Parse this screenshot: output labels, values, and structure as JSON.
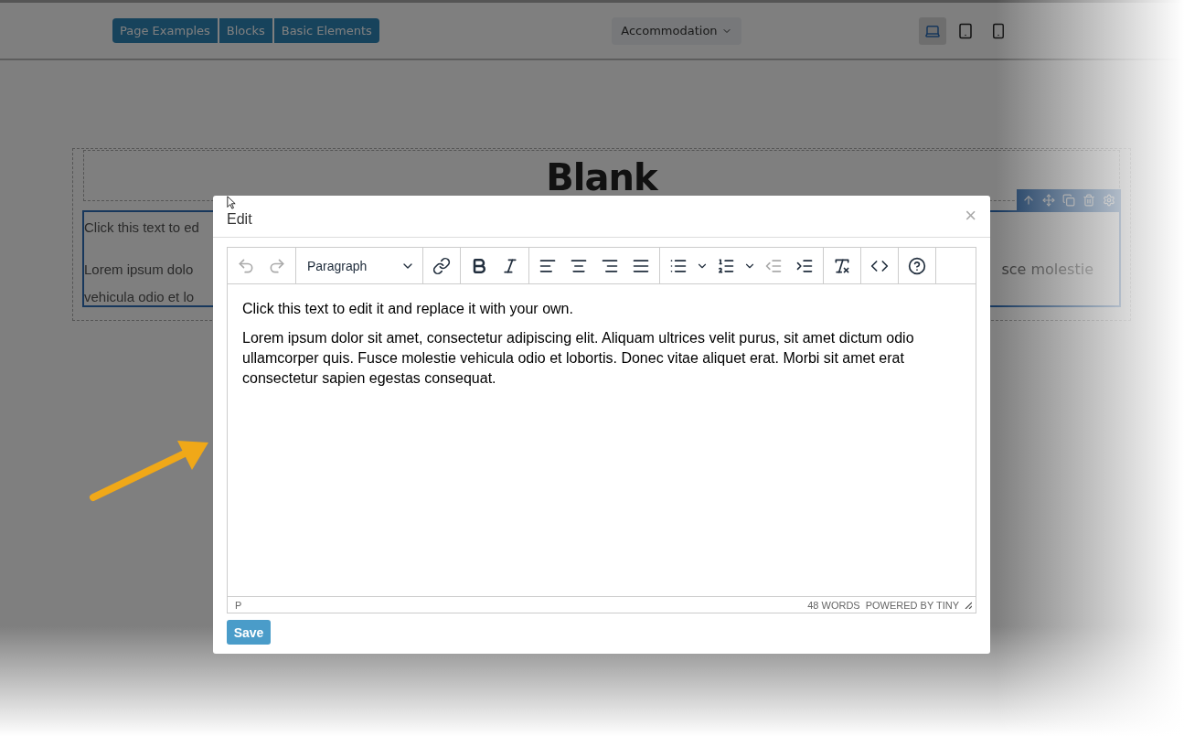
{
  "top_bar": {
    "nav_tabs": [
      {
        "label": "Page Examples"
      },
      {
        "label": "Blocks"
      },
      {
        "label": "Basic Elements"
      }
    ],
    "page_select": {
      "value": "Accommodation"
    },
    "devices": [
      {
        "kind": "desktop",
        "selected": true
      },
      {
        "kind": "tablet",
        "selected": false
      },
      {
        "kind": "mobile",
        "selected": false
      }
    ]
  },
  "canvas": {
    "heading": "Blank",
    "block_lines": [
      "Click this text to ed",
      "Lorem ipsum dolo",
      "vehicula odio et lo"
    ],
    "block_line_right": "sce molestie",
    "block_tools": [
      {
        "kind": "up"
      },
      {
        "kind": "move"
      },
      {
        "kind": "copy"
      },
      {
        "kind": "delete"
      },
      {
        "kind": "settings"
      }
    ]
  },
  "dialog": {
    "title": "Edit",
    "close": "×",
    "toolbar": [
      {
        "buttons": [
          {
            "kind": "undo",
            "disabled": true
          },
          {
            "kind": "redo",
            "disabled": true
          }
        ]
      },
      {
        "select": "Paragraph"
      },
      {
        "buttons": [
          {
            "kind": "link",
            "disabled": false
          }
        ]
      },
      {
        "buttons": [
          {
            "kind": "bold",
            "disabled": false
          },
          {
            "kind": "italic",
            "disabled": false
          }
        ]
      },
      {
        "buttons": [
          {
            "kind": "align-left",
            "disabled": false
          },
          {
            "kind": "align-center",
            "disabled": false
          },
          {
            "kind": "align-right",
            "disabled": false
          },
          {
            "kind": "justify",
            "disabled": false
          }
        ]
      },
      {
        "buttons": [
          {
            "kind": "bullet-list",
            "disabled": false
          },
          {
            "kind": "list-caret",
            "disabled": false
          },
          {
            "kind": "numbered-list",
            "disabled": false
          },
          {
            "kind": "list-caret",
            "disabled": false
          },
          {
            "kind": "outdent",
            "disabled": true
          },
          {
            "kind": "indent",
            "disabled": false
          }
        ]
      },
      {
        "buttons": [
          {
            "kind": "clear-format",
            "disabled": false
          }
        ]
      },
      {
        "buttons": [
          {
            "kind": "code",
            "disabled": false
          }
        ]
      },
      {
        "buttons": [
          {
            "kind": "help",
            "disabled": false
          }
        ]
      }
    ],
    "paragraphs": [
      "Click this text to edit it and replace it with your own.",
      "Lorem ipsum dolor sit amet, consectetur adipiscing elit. Aliquam ultrices velit purus, sit amet dictum odio ullamcorper quis. Fusce molestie vehicula odio et lobortis. Donec vitae aliquet erat. Morbi sit amet erat consectetur sapien egestas consequat."
    ],
    "status_path": "P",
    "word_count": "48 WORDS",
    "branding": "POWERED BY TINY",
    "save": "Save"
  }
}
